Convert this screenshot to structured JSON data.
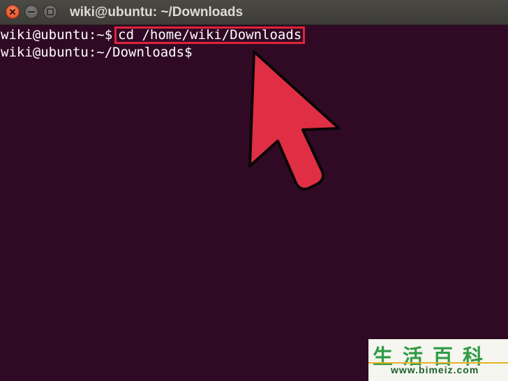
{
  "window": {
    "title": "wiki@ubuntu: ~/Downloads",
    "controls": {
      "close_icon": "close-icon",
      "minimize_icon": "minimize-icon",
      "maximize_icon": "maximize-icon"
    }
  },
  "terminal": {
    "background": "#300a24",
    "lines": [
      {
        "prompt": "wiki@ubuntu:~$",
        "command": "cd /home/wiki/Downloads"
      },
      {
        "prompt": "wiki@ubuntu:~/Downloads$",
        "command": ""
      }
    ]
  },
  "annotation": {
    "highlight_color": "#e0243a",
    "pointer_icon": "cursor-arrow-icon"
  },
  "watermark": {
    "chars": "生活百科",
    "url": "www.bimeiz.com"
  }
}
